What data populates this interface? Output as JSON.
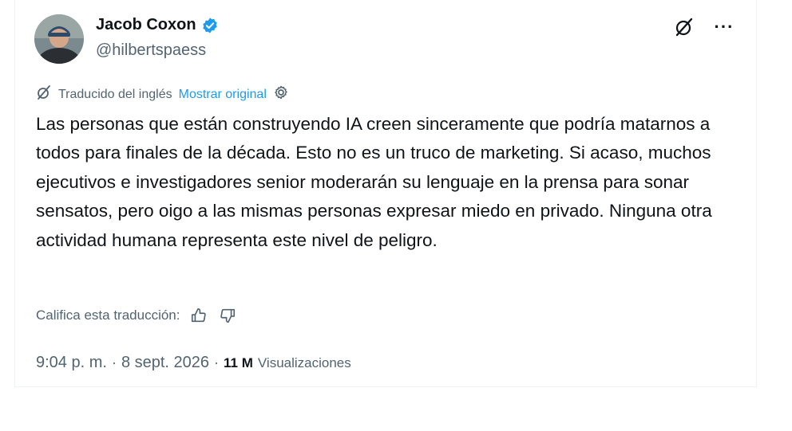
{
  "author": {
    "name": "Jacob Coxon",
    "handle": "@hilbertspaess",
    "verified_icon": "verified-badge-icon",
    "verified_color": "#1d9bf0"
  },
  "top_actions": {
    "grok_icon": "grok-slash-icon",
    "more_label": "···"
  },
  "translation": {
    "label": "Traducido del inglés",
    "show_original": "Mostrar original",
    "settings_icon": "gear-icon"
  },
  "tweet": {
    "text": "Las personas que están construyendo IA creen sinceramente que podría matarnos a todos para finales de la década. Esto no es un truco de marketing. Si acaso, muchos ejecutivos e investigadores senior moderarán su lenguaje en la prensa para sonar sensatos, pero oigo a las mismas personas expresar miedo en privado. Ninguna otra actividad humana representa este nivel de peligro."
  },
  "rating": {
    "label": "Califica esta traducción:",
    "up_icon": "thumbs-up-icon",
    "down_icon": "thumbs-down-icon"
  },
  "meta": {
    "time": "9:04 p. m.",
    "separator": "·",
    "date": "8 sept. 2026",
    "views_count": "11 M",
    "views_label": "Visualizaciones"
  },
  "colors": {
    "accent": "#1d9bf0",
    "secondary_text": "#536471",
    "primary_text": "#0f1419"
  }
}
